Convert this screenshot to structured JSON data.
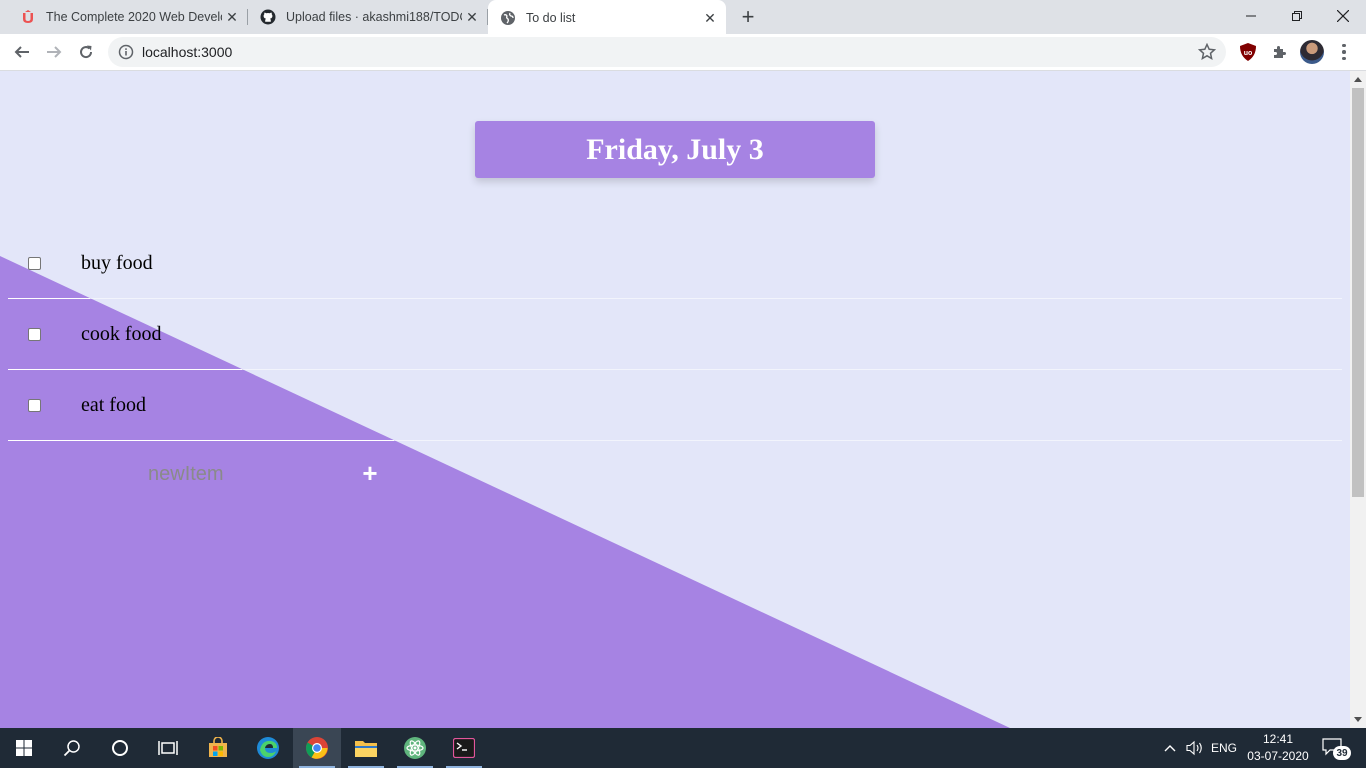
{
  "browser": {
    "tabs": [
      {
        "title": "The Complete 2020 Web Develop",
        "icon": "udemy-icon",
        "active": false
      },
      {
        "title": "Upload files · akashmi188/TODO",
        "icon": "github-icon",
        "active": false
      },
      {
        "title": "To do list",
        "icon": "globe-icon",
        "active": true
      }
    ],
    "url": "localhost:3000"
  },
  "page": {
    "date_heading": "Friday, July 3",
    "items": [
      {
        "label": "buy food",
        "checked": false
      },
      {
        "label": "cook food",
        "checked": false
      },
      {
        "label": "eat food",
        "checked": false
      }
    ],
    "new_item_placeholder": "newItem",
    "add_button_label": "+"
  },
  "taskbar": {
    "language": "ENG",
    "time": "12:41",
    "date": "03-07-2020",
    "notification_count": "39"
  },
  "colors": {
    "page_bg": "#e3e6f9",
    "accent": "#a683e3"
  }
}
